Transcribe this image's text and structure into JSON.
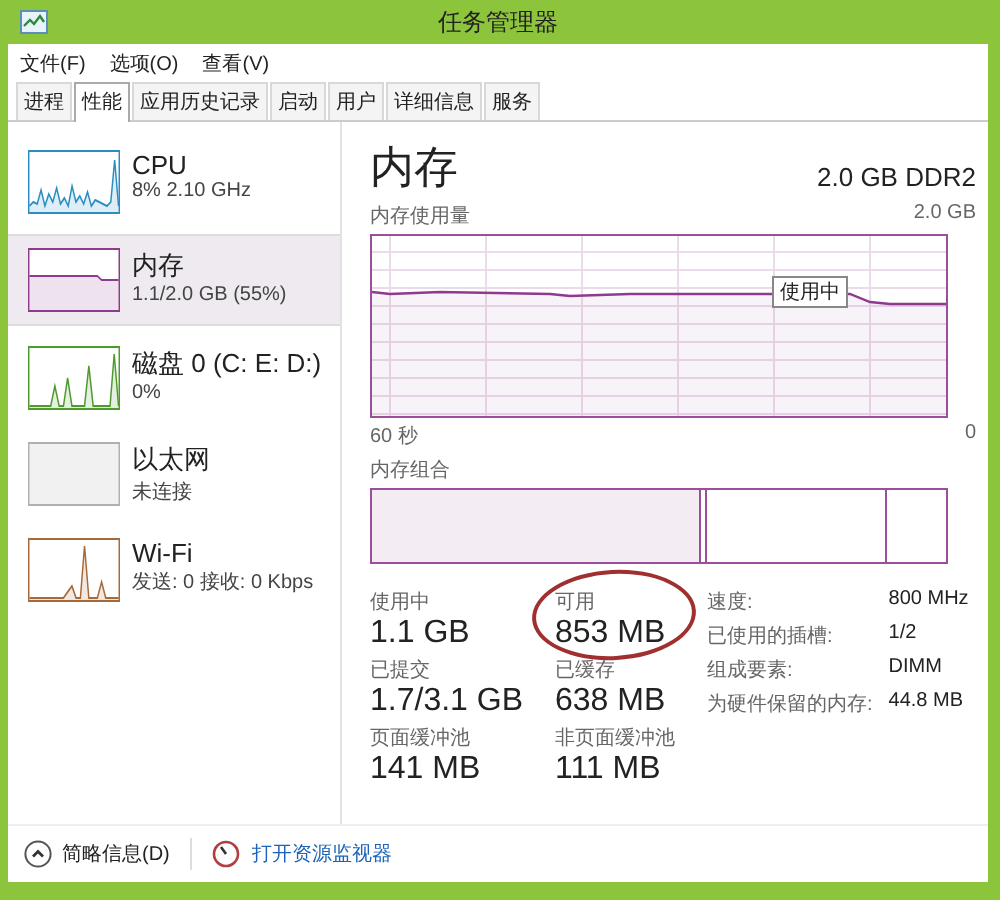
{
  "window": {
    "title": "任务管理器"
  },
  "menu": [
    "文件(F)",
    "选项(O)",
    "查看(V)"
  ],
  "tabs": [
    {
      "label": "进程",
      "selected": false
    },
    {
      "label": "性能",
      "selected": true
    },
    {
      "label": "应用历史记录",
      "selected": false
    },
    {
      "label": "启动",
      "selected": false
    },
    {
      "label": "用户",
      "selected": false
    },
    {
      "label": "详细信息",
      "selected": false
    },
    {
      "label": "服务",
      "selected": false
    }
  ],
  "sidebar": {
    "items": [
      {
        "kind": "cpu",
        "name": "CPU",
        "detail": "8% 2.10 GHz",
        "color": "#2a8dc4",
        "selected": false
      },
      {
        "kind": "memory",
        "name": "内存",
        "detail": "1.1/2.0 GB (55%)",
        "color": "#8e3a8e",
        "selected": true
      },
      {
        "kind": "disk",
        "name": "磁盘 0 (C: E: D:)",
        "detail": "0%",
        "color": "#4f9a2c",
        "selected": false
      },
      {
        "kind": "idle",
        "name": "以太网",
        "detail": "未连接",
        "color": "#b0b0b0",
        "selected": false
      },
      {
        "kind": "network",
        "name": "Wi-Fi",
        "detail": "发送: 0 接收: 0 Kbps",
        "color": "#a7683a",
        "selected": false
      }
    ]
  },
  "detail": {
    "title": "内存",
    "capacity": "2.0 GB DDR2",
    "usage_graph": {
      "label": "内存使用量",
      "max": "2.0 GB",
      "time_start": "60 秒",
      "time_end": "0",
      "tooltip": "使用中"
    },
    "composition_label": "内存组合",
    "stats": [
      {
        "label": "使用中",
        "value": "1.1 GB",
        "circled": false
      },
      {
        "label": "可用",
        "value": "853 MB",
        "circled": true
      },
      {
        "label": "已提交",
        "value": "1.7/3.1 GB",
        "circled": false
      },
      {
        "label": "已缓存",
        "value": "638 MB",
        "circled": false
      },
      {
        "label": "页面缓冲池",
        "value": "141 MB",
        "circled": false
      },
      {
        "label": "非页面缓冲池",
        "value": "111 MB",
        "circled": false
      }
    ],
    "properties": [
      {
        "label": "速度:",
        "value": "800 MHz"
      },
      {
        "label": "已使用的插槽:",
        "value": "1/2"
      },
      {
        "label": "组成要素:",
        "value": "DIMM"
      },
      {
        "label": "为硬件保留的内存:",
        "value": "44.8 MB"
      }
    ]
  },
  "footer": {
    "summary": "简略信息(D)",
    "link": "打开资源监视器"
  }
}
